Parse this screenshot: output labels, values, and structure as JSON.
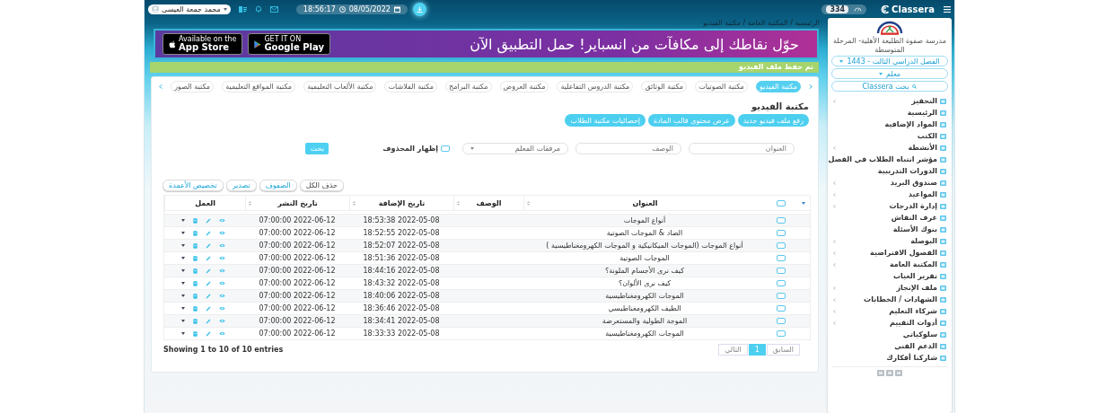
{
  "top_bar": {
    "user_name": "محمد جمعة العيسى",
    "time": "18:56:17",
    "date": "08/05/2022",
    "points": "334",
    "brand": "Classera"
  },
  "breadcrumb": "الرئيسية / المكتبة العامة / مكتبة الفيديو",
  "banner": {
    "headline": "حوّل نقاطك إلى مكافآت من انسباير! حمل التطبيق الآن",
    "stores": [
      {
        "kind": "google",
        "small": "GET IT ON",
        "big": "Google Play"
      },
      {
        "kind": "apple",
        "small": "Available on the",
        "big": "App Store"
      }
    ]
  },
  "alert": "تم حفظ ملف الفيديو",
  "tabs": [
    {
      "label": "مكتبة الفيديو",
      "selected": true
    },
    {
      "label": "مكتبة الصوتيات",
      "selected": false
    },
    {
      "label": "مكتبة الوثائق",
      "selected": false
    },
    {
      "label": "مكتبة الدروس التفاعلية",
      "selected": false
    },
    {
      "label": "مكتبة العروض",
      "selected": false
    },
    {
      "label": "مكتبة البرامج",
      "selected": false
    },
    {
      "label": "مكتبة الفلاشات",
      "selected": false
    },
    {
      "label": "مكتبة الألعاب التعليمية",
      "selected": false
    },
    {
      "label": "مكتبة المواقع التعليمية",
      "selected": false
    },
    {
      "label": "مكتبة الصور",
      "selected": false
    }
  ],
  "page_title": "مكتبة الفيديو",
  "actions": [
    "رفع ملف فيديو جديد",
    "عرض محتوى قالب المادة",
    "إحصائيات مكتبة الطلاب"
  ],
  "filters": {
    "title_placeholder": "العنوان",
    "description_placeholder": "الوصف",
    "attachments_select": "مرفقات المعلم",
    "show_deleted": {
      "label": "إظهار المحذوف",
      "checked": false
    },
    "search_button": "بحث"
  },
  "table": {
    "toolbar": [
      "حذف الكل",
      "الصفوف",
      "تصدير",
      "تخصيص الأعمدة"
    ],
    "select_all": {
      "checked": false
    },
    "columns": [
      "العنوان",
      "الوصف",
      "تاريخ الإضافة",
      "تاريخ النشر",
      "العمل"
    ],
    "rows": [
      {
        "title": "أنواع الموجات",
        "added": "18:53:38 2022-05-08",
        "published": "07:00:00 2022-06-12",
        "checked": false
      },
      {
        "title": "الضاد & الموجات الصوتية",
        "added": "18:52:55 2022-05-08",
        "published": "07:00:00 2022-06-12",
        "checked": false
      },
      {
        "title": "أنواع الموجات (الموجات الميكانيكية و الموجات الكهرومغناطيسية )",
        "added": "18:52:07 2022-05-08",
        "published": "07:00:00 2022-06-12",
        "checked": false
      },
      {
        "title": "الموجات الصوتية",
        "added": "18:51:36 2022-05-08",
        "published": "07:00:00 2022-06-12",
        "checked": false
      },
      {
        "title": "كيف نرى الأجسام الملونة؟",
        "added": "18:44:16 2022-05-08",
        "published": "07:00:00 2022-06-12",
        "checked": false
      },
      {
        "title": "كيف نرى الألوان؟",
        "added": "18:43:32 2022-05-08",
        "published": "07:00:00 2022-06-12",
        "checked": false
      },
      {
        "title": "الموجات الكهرومغناطيسية",
        "added": "18:40:06 2022-05-08",
        "published": "07:00:00 2022-06-12",
        "checked": false
      },
      {
        "title": "الطيف الكهرومغناطيسي",
        "added": "18:36:46 2022-05-08",
        "published": "07:00:00 2022-06-12",
        "checked": false
      },
      {
        "title": "الموجة الطولية والمستعرضة",
        "added": "18:34:41 2022-05-08",
        "published": "07:00:00 2022-06-12",
        "checked": false
      },
      {
        "title": "الموجات الكهرومغناطيسية",
        "added": "18:33:33 2022-05-08",
        "published": "07:00:00 2022-06-12",
        "checked": false
      }
    ],
    "footer": "Showing 1 to 10 of 10 entries",
    "pagination": [
      {
        "label": "السابق",
        "selected": false,
        "disabled": true
      },
      {
        "label": "1",
        "selected": true,
        "disabled": false
      },
      {
        "label": "التالي",
        "selected": false,
        "disabled": true
      }
    ]
  },
  "sidebar": {
    "school": "مدرسة صفوة الطليعة الأهلية- المرحلة المتوسطة",
    "semester": "الفصل الدراسي الثالث - 1443",
    "role": "معلم",
    "search_placeholder": "بحث Classera",
    "items": [
      {
        "label": "التحفيز",
        "expandable": true
      },
      {
        "label": "الرئيسية",
        "expandable": false
      },
      {
        "label": "المواد الإضافية",
        "expandable": false
      },
      {
        "label": "الكتب",
        "expandable": false
      },
      {
        "label": "الأنشطة",
        "expandable": true
      },
      {
        "label": "مؤشر انتباه الطلاب في الفصل",
        "expandable": false
      },
      {
        "label": "الدورات التدريبية",
        "expandable": false
      },
      {
        "label": "صندوق البريد",
        "expandable": true
      },
      {
        "label": "المواعيد",
        "expandable": true
      },
      {
        "label": "إدارة الدرجات",
        "expandable": true
      },
      {
        "label": "غرف النقاش",
        "expandable": false
      },
      {
        "label": "بنوك الأسئلة",
        "expandable": false
      },
      {
        "label": "البوصلة",
        "expandable": true
      },
      {
        "label": "الفصول الافتراضية",
        "expandable": true
      },
      {
        "label": "المكتبة العامة",
        "expandable": true
      },
      {
        "label": "تقرير الغياب",
        "expandable": false
      },
      {
        "label": "ملف الإنجاز",
        "expandable": true
      },
      {
        "label": "الشهادات / الخطابات",
        "expandable": true
      },
      {
        "label": "شركاء التعليم",
        "expandable": true
      },
      {
        "label": "أدوات التقييم",
        "expandable": true
      },
      {
        "label": "سلوكياتي",
        "expandable": false
      },
      {
        "label": "الدعم الفني",
        "expandable": false
      },
      {
        "label": "شاركنا أفكارك",
        "expandable": false
      }
    ]
  }
}
